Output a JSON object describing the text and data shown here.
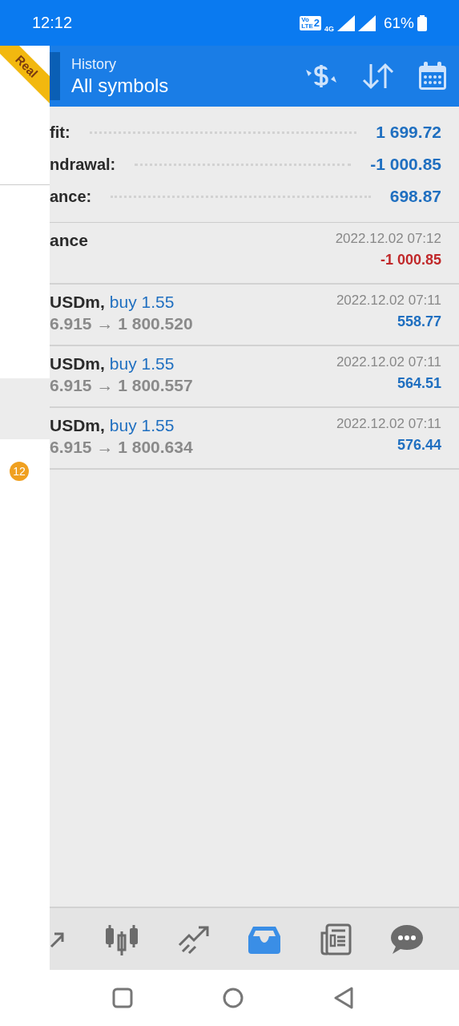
{
  "status_bar": {
    "time": "12:12",
    "volte": {
      "top": "Vo",
      "bottom": "LTE",
      "sim": "2"
    },
    "network": "4G",
    "battery": "61%"
  },
  "account_ribbon": "Real",
  "header": {
    "title": "History",
    "subtitle": "All symbols"
  },
  "summary": [
    {
      "label": "fit:",
      "value": "1 699.72"
    },
    {
      "label": "ndrawal:",
      "value": "-1 000.85"
    },
    {
      "label": "ance:",
      "value": "698.87"
    }
  ],
  "deals": [
    {
      "kind": "balance",
      "name": "ance",
      "time": "2022.12.02 07:12",
      "result": "-1 000.85",
      "negative": true
    },
    {
      "kind": "trade",
      "name": "USDm,",
      "side": "buy 1.55",
      "prices": "6.915 → 1 800.520",
      "time": "2022.12.02 07:11",
      "result": "558.77",
      "negative": false
    },
    {
      "kind": "trade",
      "name": "USDm,",
      "side": "buy 1.55",
      "prices": "6.915 → 1 800.557",
      "time": "2022.12.02 07:11",
      "result": "564.51",
      "negative": false
    },
    {
      "kind": "trade",
      "name": "USDm,",
      "side": "buy 1.55",
      "prices": "6.915 → 1 800.634",
      "time": "2022.12.02 07:11",
      "result": "576.44",
      "negative": false
    }
  ],
  "drawer": {
    "badge": "12"
  },
  "bottom_nav": [
    {
      "kind": "arrow",
      "selected": false
    },
    {
      "kind": "candles",
      "selected": false
    },
    {
      "kind": "trend",
      "selected": false
    },
    {
      "kind": "inbox",
      "selected": true
    },
    {
      "kind": "news",
      "selected": false
    },
    {
      "kind": "chat",
      "selected": false
    }
  ]
}
